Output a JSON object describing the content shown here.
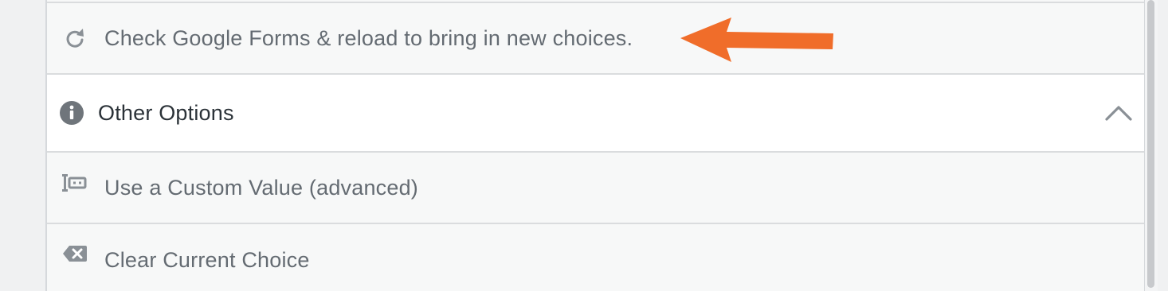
{
  "reload_row": {
    "label": "Check Google Forms & reload to bring in new choices.",
    "icon": "refresh-icon"
  },
  "other_options": {
    "title": "Other Options",
    "icon": "info-icon",
    "toggle_icon": "chevron-up-icon",
    "expanded": true
  },
  "options": [
    {
      "label": "Use a Custom Value (advanced)",
      "icon": "custom-field-icon"
    },
    {
      "label": "Clear Current Choice",
      "icon": "clear-backspace-icon"
    }
  ],
  "annotation": {
    "icon": "arrow-pointer-icon",
    "color": "#f06d2a"
  },
  "colors": {
    "row_background": "#f7f8f8",
    "header_background": "#ffffff",
    "muted_text": "#646b72",
    "dark_text": "#2b3238",
    "icon_gray": "#8a9096"
  }
}
